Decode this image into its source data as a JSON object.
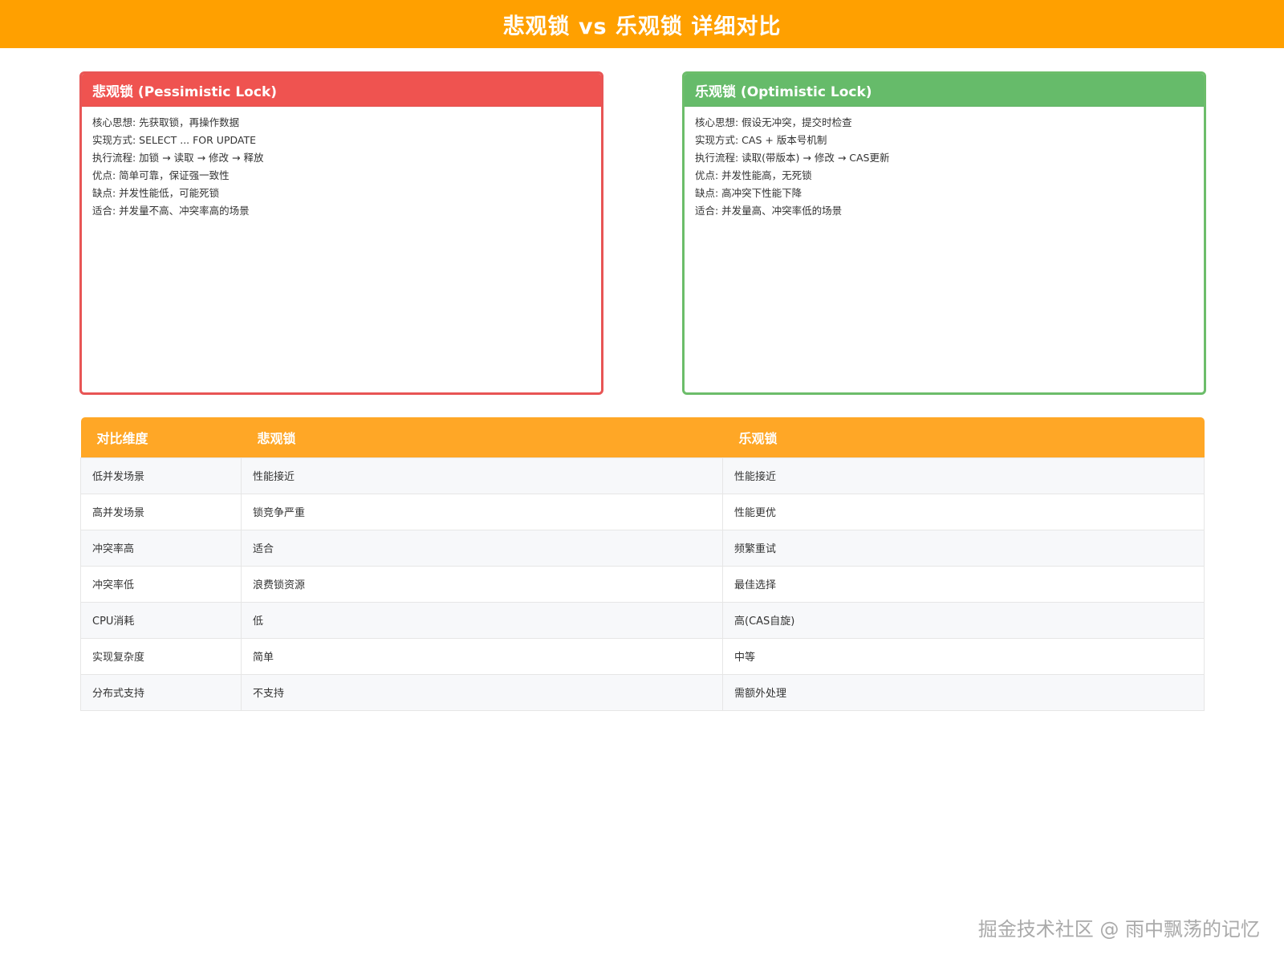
{
  "header": {
    "title": "悲观锁 vs 乐观锁 详细对比"
  },
  "pessimistic": {
    "title": "悲观锁 (Pessimistic Lock)",
    "lines": [
      "核心思想: 先获取锁，再操作数据",
      "实现方式: SELECT ... FOR UPDATE",
      "执行流程: 加锁 → 读取 → 修改 → 释放",
      "优点: 简单可靠，保证强一致性",
      "缺点: 并发性能低，可能死锁",
      "适合: 并发量不高、冲突率高的场景"
    ]
  },
  "optimistic": {
    "title": "乐观锁 (Optimistic Lock)",
    "lines": [
      "核心思想: 假设无冲突，提交时检查",
      "实现方式: CAS + 版本号机制",
      "执行流程: 读取(带版本) → 修改 → CAS更新",
      "优点: 并发性能高，无死锁",
      "缺点: 高冲突下性能下降",
      "适合: 并发量高、冲突率低的场景"
    ]
  },
  "table": {
    "headers": [
      "对比维度",
      "悲观锁",
      "乐观锁"
    ],
    "rows": [
      [
        "低并发场景",
        "性能接近",
        "性能接近"
      ],
      [
        "高并发场景",
        "锁竞争严重",
        "性能更优"
      ],
      [
        "冲突率高",
        "适合",
        "频繁重试"
      ],
      [
        "冲突率低",
        "浪费锁资源",
        "最佳选择"
      ],
      [
        "CPU消耗",
        "低",
        "高(CAS自旋)"
      ],
      [
        "实现复杂度",
        "简单",
        "中等"
      ],
      [
        "分布式支持",
        "不支持",
        "需额外处理"
      ]
    ]
  },
  "watermark": "掘金技术社区 @ 雨中飘荡的记忆",
  "colors": {
    "header": "#ffa000",
    "pessimistic": "#ef5350",
    "optimistic": "#66bb6a",
    "table_header": "#ffa726"
  }
}
